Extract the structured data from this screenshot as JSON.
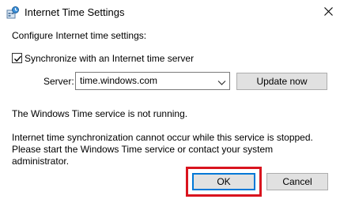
{
  "window": {
    "title": "Internet Time Settings",
    "accent_color": "#0078d7",
    "highlight_color": "#d9141e"
  },
  "icons": {
    "app": "clock-globe-icon",
    "close": "close-icon",
    "combo": "chevron-down-icon",
    "check": "check-icon"
  },
  "content": {
    "heading": "Configure Internet time settings:",
    "sync_checkbox": {
      "label": "Synchronize with an Internet time server",
      "checked": true
    },
    "server": {
      "label": "Server:",
      "value": "time.windows.com"
    },
    "update_button": "Update now",
    "status": "The Windows Time service is not running.",
    "message_lines": [
      "Internet time synchronization cannot occur while this service is stopped.",
      "Please start the Windows Time service or contact your system",
      "administrator."
    ]
  },
  "footer": {
    "ok_label": "OK",
    "cancel_label": "Cancel"
  }
}
